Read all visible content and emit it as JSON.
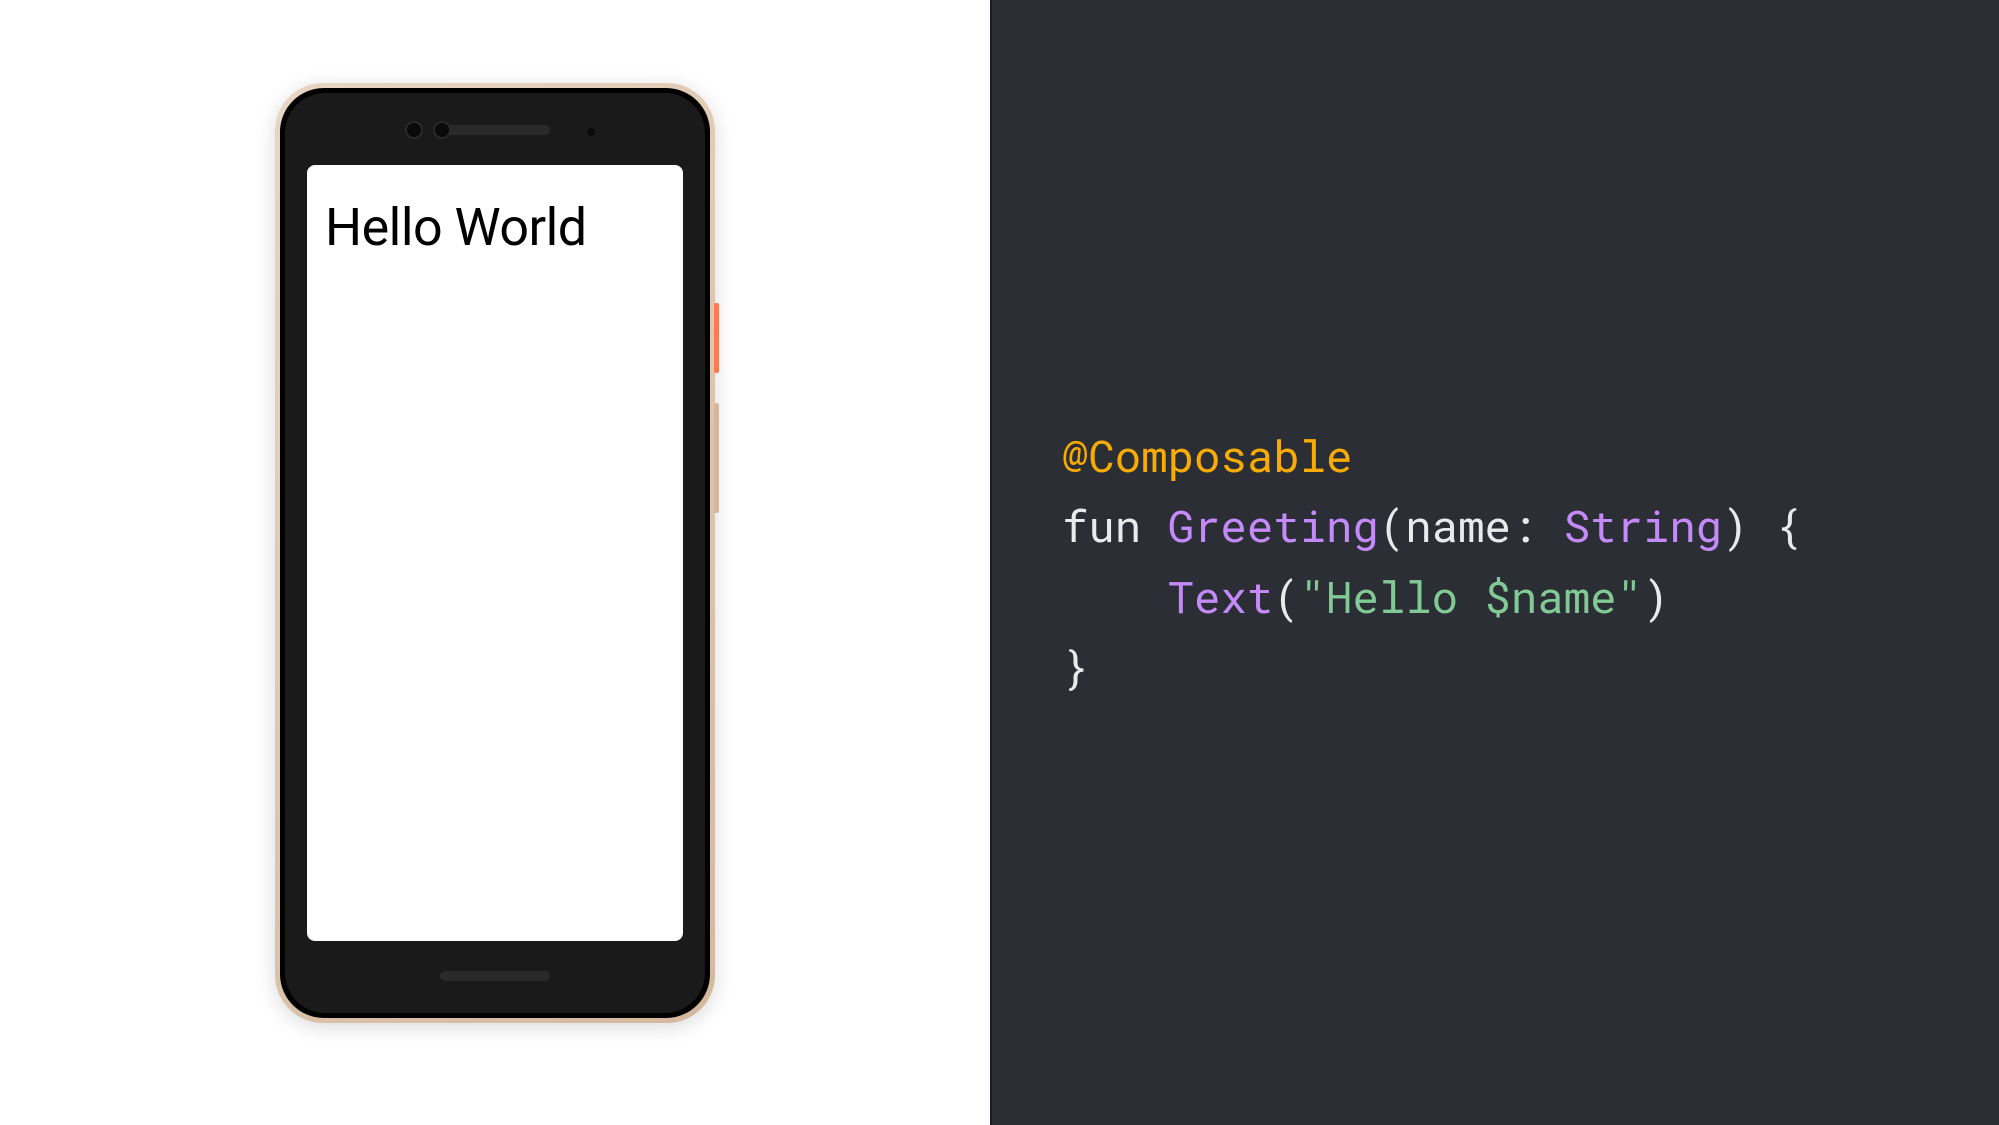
{
  "phone": {
    "screen_text": "Hello World"
  },
  "code": {
    "annotation": "@Composable",
    "keyword_fun": "fun",
    "function_greeting": "Greeting",
    "paren_open": "(",
    "param_name": "name",
    "colon_space": ": ",
    "type_string": "String",
    "paren_close_brace": ") {",
    "indent": "    ",
    "function_text": "Text",
    "text_paren_open": "(",
    "string_value": "\"Hello $name\"",
    "text_paren_close": ")",
    "closing_brace": "}"
  },
  "colors": {
    "annotation": "#f9ab00",
    "function": "#c58af9",
    "string": "#81c995",
    "text": "#e8eaed",
    "code_bg": "#2b2f35"
  }
}
